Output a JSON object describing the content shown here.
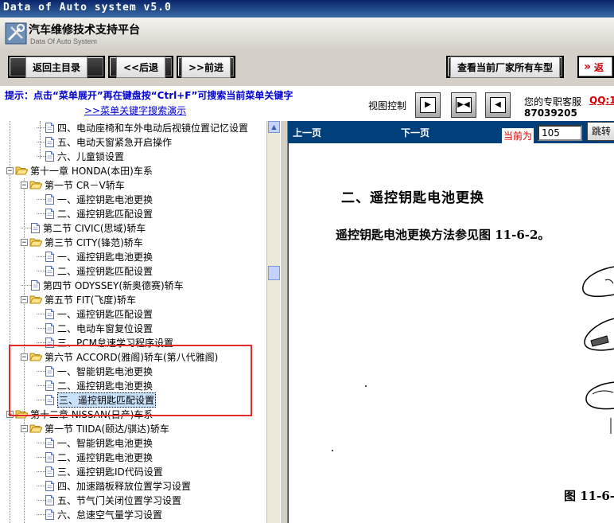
{
  "window": {
    "title": "Data of Auto system v5.0"
  },
  "header": {
    "title_cn": "汽车维修技术支持平台",
    "title_en": "Data Of Auto System"
  },
  "toolbar": {
    "home": "返回主目录",
    "back": "<<后退",
    "forward": ">>前进",
    "view_all": "查看当前厂家所有车型",
    "return_partial": "返"
  },
  "hint": {
    "text": "提示：点击“菜单展开”再在键盘按“Ctrl+F”可搜索当前菜单关键字",
    "link": ">>菜单关键字搜索演示",
    "view_control": "视图控制",
    "service_label": "您的专职客服",
    "qq_partial": "QQ:1",
    "phone_partial": "87039205"
  },
  "tree": {
    "items": [
      {
        "label": "四、电动座椅和车外电动后视镜位置记忆设置",
        "level": 3,
        "kind": "doc"
      },
      {
        "label": "五、电动天窗紧急开启操作",
        "level": 3,
        "kind": "doc"
      },
      {
        "label": "六、儿童锁设置",
        "level": 3,
        "kind": "doc"
      },
      {
        "label": "第十一章 HONDA(本田)车系",
        "level": 1,
        "kind": "folder"
      },
      {
        "label": "第一节 CR－V轿车",
        "level": 2,
        "kind": "folder"
      },
      {
        "label": "一、遥控钥匙电池更换",
        "level": 3,
        "kind": "doc"
      },
      {
        "label": "二、遥控钥匙匹配设置",
        "level": 3,
        "kind": "doc"
      },
      {
        "label": "第二节 CIVIC(思域)轿车",
        "level": 2,
        "kind": "doc"
      },
      {
        "label": "第三节 CITY(锋范)轿车",
        "level": 2,
        "kind": "folder"
      },
      {
        "label": "一、遥控钥匙电池更换",
        "level": 3,
        "kind": "doc"
      },
      {
        "label": "二、遥控钥匙匹配设置",
        "level": 3,
        "kind": "doc"
      },
      {
        "label": "第四节 ODYSSEY(新奥德赛)轿车",
        "level": 2,
        "kind": "doc"
      },
      {
        "label": "第五节 FIT(飞度)轿车",
        "level": 2,
        "kind": "folder"
      },
      {
        "label": "一、遥控钥匙匹配设置",
        "level": 3,
        "kind": "doc"
      },
      {
        "label": "二、电动车窗复位设置",
        "level": 3,
        "kind": "doc"
      },
      {
        "label": "三、PCM怠速学习程序设置",
        "level": 3,
        "kind": "doc"
      },
      {
        "label": "第六节 ACCORD(雅阁)轿车(第八代雅阁)",
        "level": 2,
        "kind": "folder"
      },
      {
        "label": "一、智能钥匙电池更换",
        "level": 3,
        "kind": "doc"
      },
      {
        "label": "二、遥控钥匙电池更换",
        "level": 3,
        "kind": "doc"
      },
      {
        "label": "三、遥控钥匙匹配设置",
        "level": 3,
        "kind": "doc",
        "selected": true
      },
      {
        "label": "第十二章 NISSAN(日产)车系",
        "level": 1,
        "kind": "folder"
      },
      {
        "label": "第一节 TIIDA(颐达/骐达)轿车",
        "level": 2,
        "kind": "folder"
      },
      {
        "label": "一、智能钥匙电池更换",
        "level": 3,
        "kind": "doc"
      },
      {
        "label": "二、遥控钥匙电池更换",
        "level": 3,
        "kind": "doc"
      },
      {
        "label": "三、遥控钥匙ID代码设置",
        "level": 3,
        "kind": "doc"
      },
      {
        "label": "四、加速踏板释放位置学习设置",
        "level": 3,
        "kind": "doc"
      },
      {
        "label": "五、节气门关闭位置学习设置",
        "level": 3,
        "kind": "doc"
      },
      {
        "label": "六、怠速空气量学习设置",
        "level": 3,
        "kind": "doc"
      }
    ]
  },
  "nav": {
    "prev": "上一页",
    "next": "下一页",
    "current_label": "当前为",
    "page": "105",
    "jump": "跳转"
  },
  "document": {
    "heading": "二、遥控钥匙电池更换",
    "paragraph": "遥控钥匙电池更换方法参见图 11-6-2。",
    "caption_partial": "图 11-6-"
  }
}
